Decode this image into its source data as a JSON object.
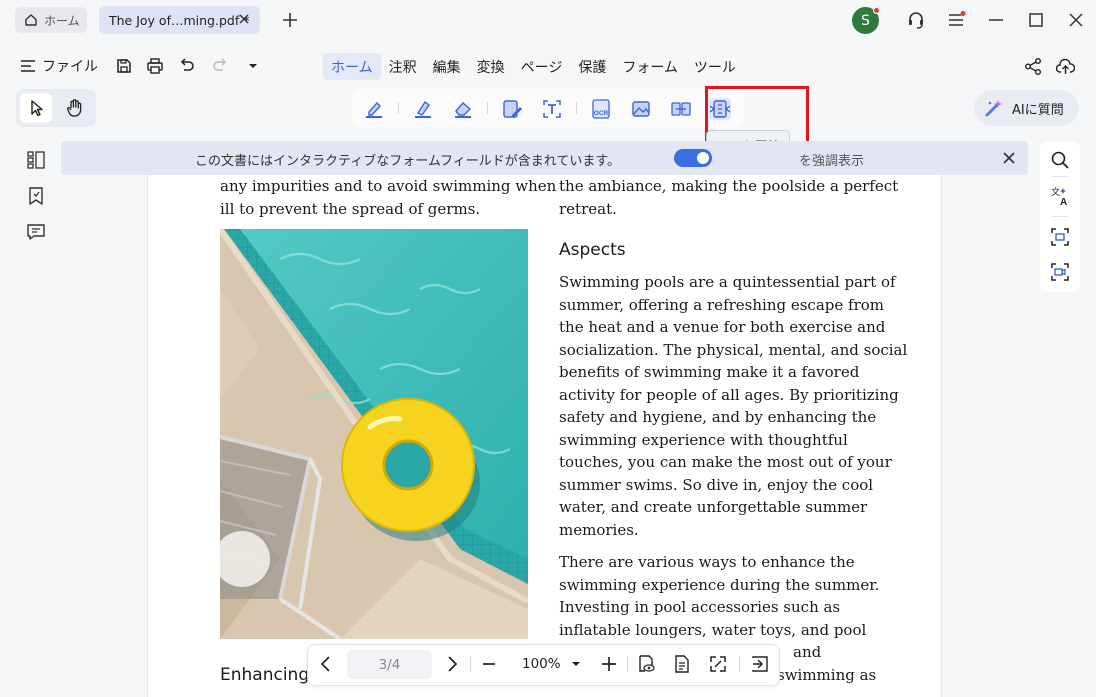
{
  "titlebar": {
    "home_tab_label": "ホーム",
    "doc_tab_label": "The Joy of…ming.pdf *",
    "avatar_initial": "S"
  },
  "menubar": {
    "file_label": "ファイル",
    "menus": [
      "ホーム",
      "注釈",
      "編集",
      "変換",
      "ページ",
      "保護",
      "フォーム",
      "ツール"
    ],
    "active_menu": "ホーム"
  },
  "toolbar": {
    "tooltip": "PDFを圧縮",
    "ai_button_label": "AIに質問"
  },
  "notice": {
    "message": "この文書にはインタラクティブなフォームフィールドが含まれています。",
    "toggle_label": "を強調表示"
  },
  "document": {
    "left_top_lines": [
      "any impurities and to avoid swimming when",
      "ill to prevent the spread of germs."
    ],
    "left_bottom_heading": "Enhancing t",
    "right_top_lines": [
      "the ambiance, making the poolside a perfect",
      "retreat."
    ],
    "aspects_heading": "Aspects",
    "para1_lines": [
      "Swimming pools are a quintessential part of",
      "summer, offering a refreshing escape from",
      "the heat and a venue for both exercise and",
      "socialization. The physical, mental, and social",
      "benefits of swimming make it a favored",
      "activity for people of all ages. By prioritizing",
      "safety and hygiene, and by enhancing the",
      "swimming experience with thoughtful",
      "touches, you can make the most out of your",
      "summer swims. So dive in, enjoy the cool",
      "water, and create unforgettable summer",
      "memories."
    ],
    "para2_lines": [
      "There are various ways to enhance the",
      "swimming experience during the summer.",
      "Investing in pool accessories such as",
      "inflatable loungers, water toys, and pool",
      "and",
      "swimming as"
    ]
  },
  "bottombar": {
    "page_indicator": "3/4",
    "zoom": "100%"
  }
}
